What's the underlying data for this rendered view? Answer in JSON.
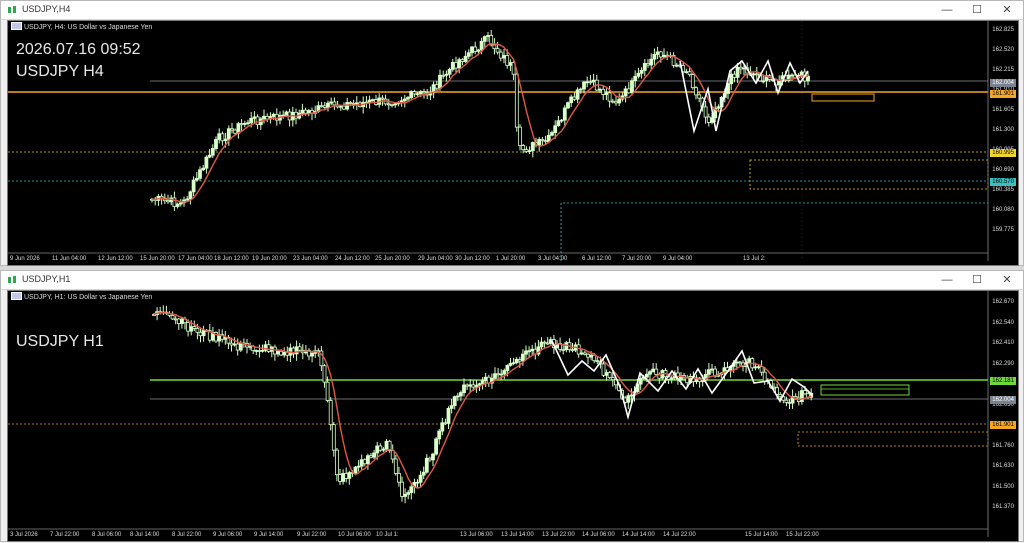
{
  "h4": {
    "window_title": "USDJPY,H4",
    "ticker": "USDJPY, H4:  US Dollar vs Japanese Yen",
    "overlay_date": "2026.07.16 09:52",
    "overlay_symbol": "USDJPY H4",
    "price_labels": [
      "162.825",
      "162.520",
      "162.215",
      "161.910",
      "161.605",
      "161.300",
      "160.995",
      "160.690",
      "160.385",
      "160.080",
      "159.775"
    ],
    "tags": [
      {
        "label": "162.004",
        "bg": "#7a8190",
        "fg": "#ffffff"
      },
      {
        "label": "161.901",
        "bg": "#f5a623",
        "fg": "#000000"
      },
      {
        "label": "160.995",
        "bg": "#f2d630",
        "fg": "#000000"
      },
      {
        "label": "160.570",
        "bg": "#39c0c0",
        "fg": "#000000"
      }
    ],
    "time_labels": [
      "9 Jun 2026",
      "11 Jun 04:00",
      "12 Jun 12:00",
      "15 Jun 20:00",
      "17 Jun 04:00",
      "18 Jun 12:00",
      "19 Jun 20:00",
      "23 Jun 04:00",
      "24 Jun 12:00",
      "25 Jun 20:00",
      "29 Jun 04:00",
      "30 Jun 12:00",
      "1 Jul 20:00",
      "3 Jul 04:00",
      "6 Jul 12:00",
      "7 Jul 20:00",
      "9 Jul 04:00",
      "13 Jul 2:"
    ]
  },
  "h1": {
    "window_title": "USDJPY,H1",
    "ticker": "USDJPY, H1:  US Dollar vs Japanese Yen",
    "overlay_symbol": "USDJPY H1",
    "price_labels": [
      "162.670",
      "162.540",
      "162.410",
      "162.290",
      "162.160",
      "162.030",
      "161.900",
      "161.760",
      "161.630",
      "161.500",
      "161.370"
    ],
    "tags": [
      {
        "label": "162.181",
        "bg": "#6fd93a",
        "fg": "#000000"
      },
      {
        "label": "162.004",
        "bg": "#7a8190",
        "fg": "#ffffff"
      },
      {
        "label": "161.901",
        "bg": "#f5a623",
        "fg": "#000000"
      }
    ],
    "time_labels": [
      "3 Jul 2026",
      "7 Jul 22:00",
      "8 Jul 06:00",
      "8 Jul 14:00",
      "8 Jul 22:00",
      "9 Jul 06:00",
      "9 Jul 14:00",
      "9 Jul 22:00",
      "10 Jul 06:00",
      "10 Jul 1:",
      "13 Jul 06:00",
      "13 Jul 14:00",
      "13 Jul 22:00",
      "14 Jul 06:00",
      "14 Jul 14:00",
      "14 Jul 22:00",
      "15 Jul 14:00",
      "15 Jul 22:00"
    ]
  },
  "controls": {
    "minimize": "—",
    "maximize": "☐",
    "close": "✕"
  },
  "colors": {
    "bull": "#d8ffc8",
    "bear": "#ffffff",
    "ma": "#e05a44",
    "zigzag": "#ffffff",
    "accent": "#1a6aff"
  }
}
